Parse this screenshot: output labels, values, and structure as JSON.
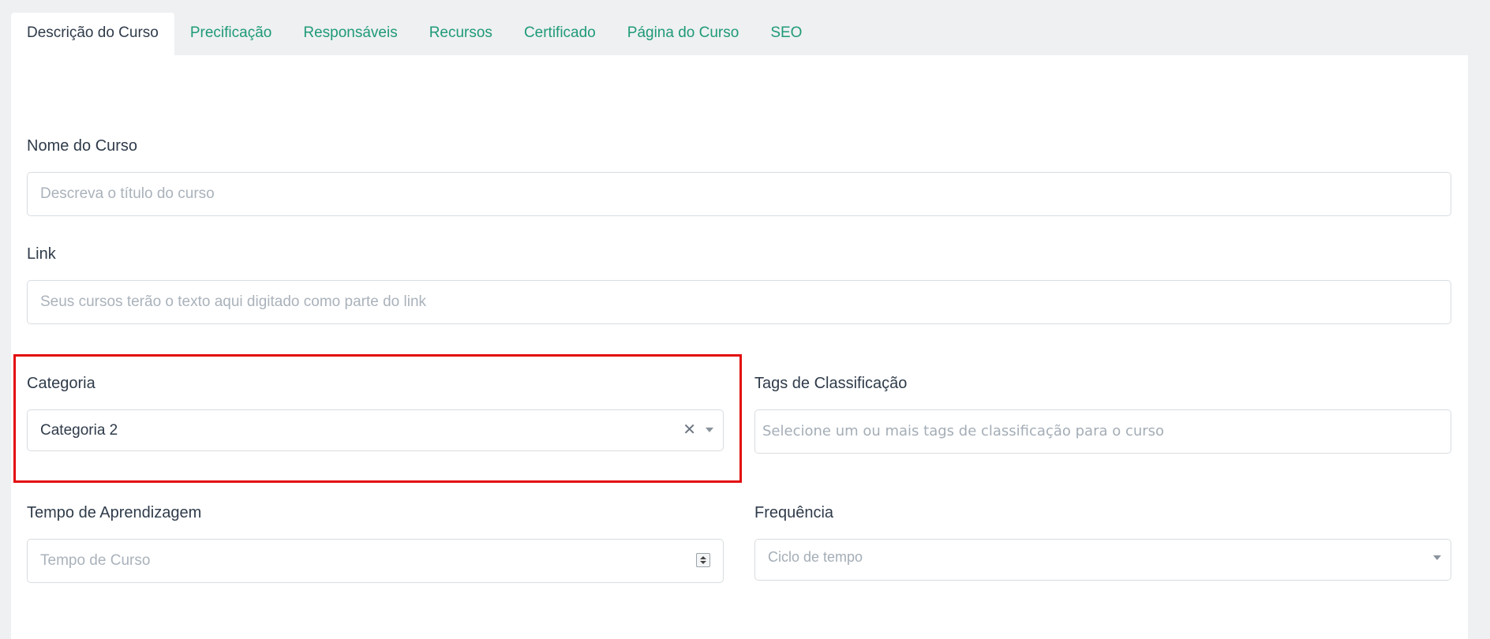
{
  "tabs": [
    {
      "label": "Descrição do Curso",
      "active": true
    },
    {
      "label": "Precificação",
      "active": false
    },
    {
      "label": "Responsáveis",
      "active": false
    },
    {
      "label": "Recursos",
      "active": false
    },
    {
      "label": "Certificado",
      "active": false
    },
    {
      "label": "Página do Curso",
      "active": false
    },
    {
      "label": "SEO",
      "active": false
    }
  ],
  "form": {
    "nome": {
      "label": "Nome do Curso",
      "placeholder": "Descreva o título do curso",
      "value": ""
    },
    "link": {
      "label": "Link",
      "placeholder": "Seus cursos terão o texto aqui digitado como parte do link",
      "value": ""
    },
    "categoria": {
      "label": "Categoria",
      "value": "Categoria 2",
      "clear_icon": "close-icon"
    },
    "tags": {
      "label": "Tags de Classificação",
      "placeholder": "Selecione um ou mais tags de classificação para o curso"
    },
    "tempo": {
      "label": "Tempo de Aprendizagem",
      "placeholder": "Tempo de Curso",
      "value": ""
    },
    "frequencia": {
      "label": "Frequência",
      "placeholder": "Ciclo de tempo"
    }
  },
  "colors": {
    "tab_link": "#1f9a78",
    "highlight": "#e30d0d",
    "background": "#eef0f1"
  }
}
